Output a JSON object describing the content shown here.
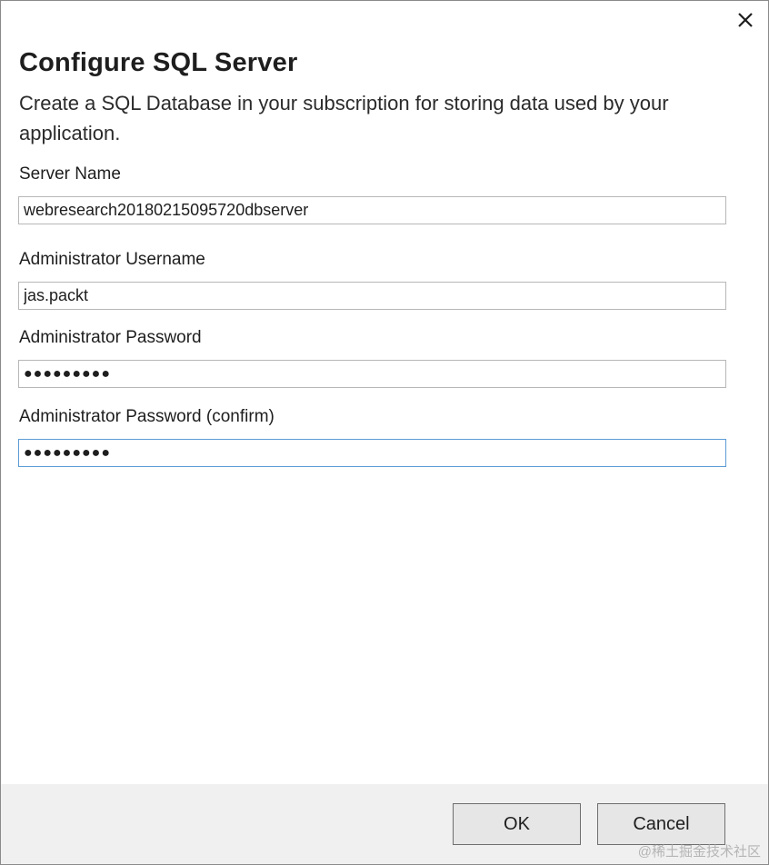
{
  "dialog": {
    "title": "Configure SQL Server",
    "description": "Create a SQL Database in your subscription for storing data used by your application."
  },
  "form": {
    "server_name": {
      "label": "Server Name",
      "value": "webresearch20180215095720dbserver"
    },
    "admin_username": {
      "label": "Administrator Username",
      "value": "jas.packt"
    },
    "admin_password": {
      "label": "Administrator Password",
      "value": "●●●●●●●●●"
    },
    "admin_password_confirm": {
      "label": "Administrator Password (confirm)",
      "value": "●●●●●●●●●"
    }
  },
  "buttons": {
    "ok": "OK",
    "cancel": "Cancel"
  },
  "icons": {
    "close": "close-icon"
  },
  "colors": {
    "focus_border": "#5b9bd5",
    "footer_bg": "#f0f0f0"
  },
  "watermark": "@稀土掘金技术社区"
}
